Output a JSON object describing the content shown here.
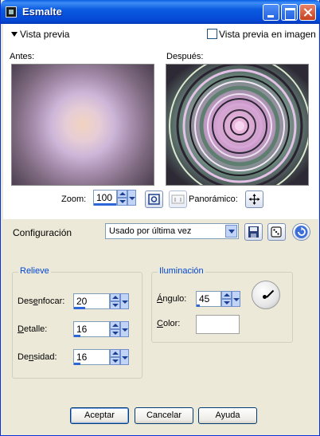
{
  "window": {
    "title": "Esmalte"
  },
  "preview": {
    "toggle_label": "Vista previa",
    "image_preview_label": "Vista previa en imagen",
    "before_label": "Antes:",
    "after_label": "Después:",
    "zoom_label": "Zoom:",
    "zoom_value": "100",
    "panoramic_label": "Panorámico:"
  },
  "config": {
    "label": "Configuración",
    "selected": "Usado por última vez"
  },
  "relief": {
    "title": "Relieve",
    "blur_label_pre": "Des",
    "blur_label_ul": "e",
    "blur_label_post": "nfocar:",
    "blur_value": "20",
    "detail_label_ul": "D",
    "detail_label_post": "etalle:",
    "detail_value": "16",
    "density_label_pre": "De",
    "density_label_ul": "n",
    "density_label_post": "sidad:",
    "density_value": "16"
  },
  "lighting": {
    "title": "Iluminación",
    "angle_label_ul": "Á",
    "angle_label_post": "ngulo:",
    "angle_value": "45",
    "color_label_ul": "C",
    "color_label_post": "olor:"
  },
  "buttons": {
    "ok": "Aceptar",
    "cancel": "Cancelar",
    "help": "Ayuda"
  },
  "icons": {
    "app": "app-icon",
    "minimize": "minimize-icon",
    "maximize": "maximize-icon",
    "close": "close-icon",
    "zoom_fit": "zoom-fit-icon",
    "actual_size": "actual-size-icon",
    "pan": "move-icon",
    "save_preset": "save-icon",
    "randomize": "dice-icon",
    "reset": "reset-icon"
  },
  "colors": {
    "title_bar": "#0a5ae0",
    "group_title": "#0046d5",
    "dialog_bg": "#ece9d8",
    "value_bar": "#2c66d8"
  }
}
